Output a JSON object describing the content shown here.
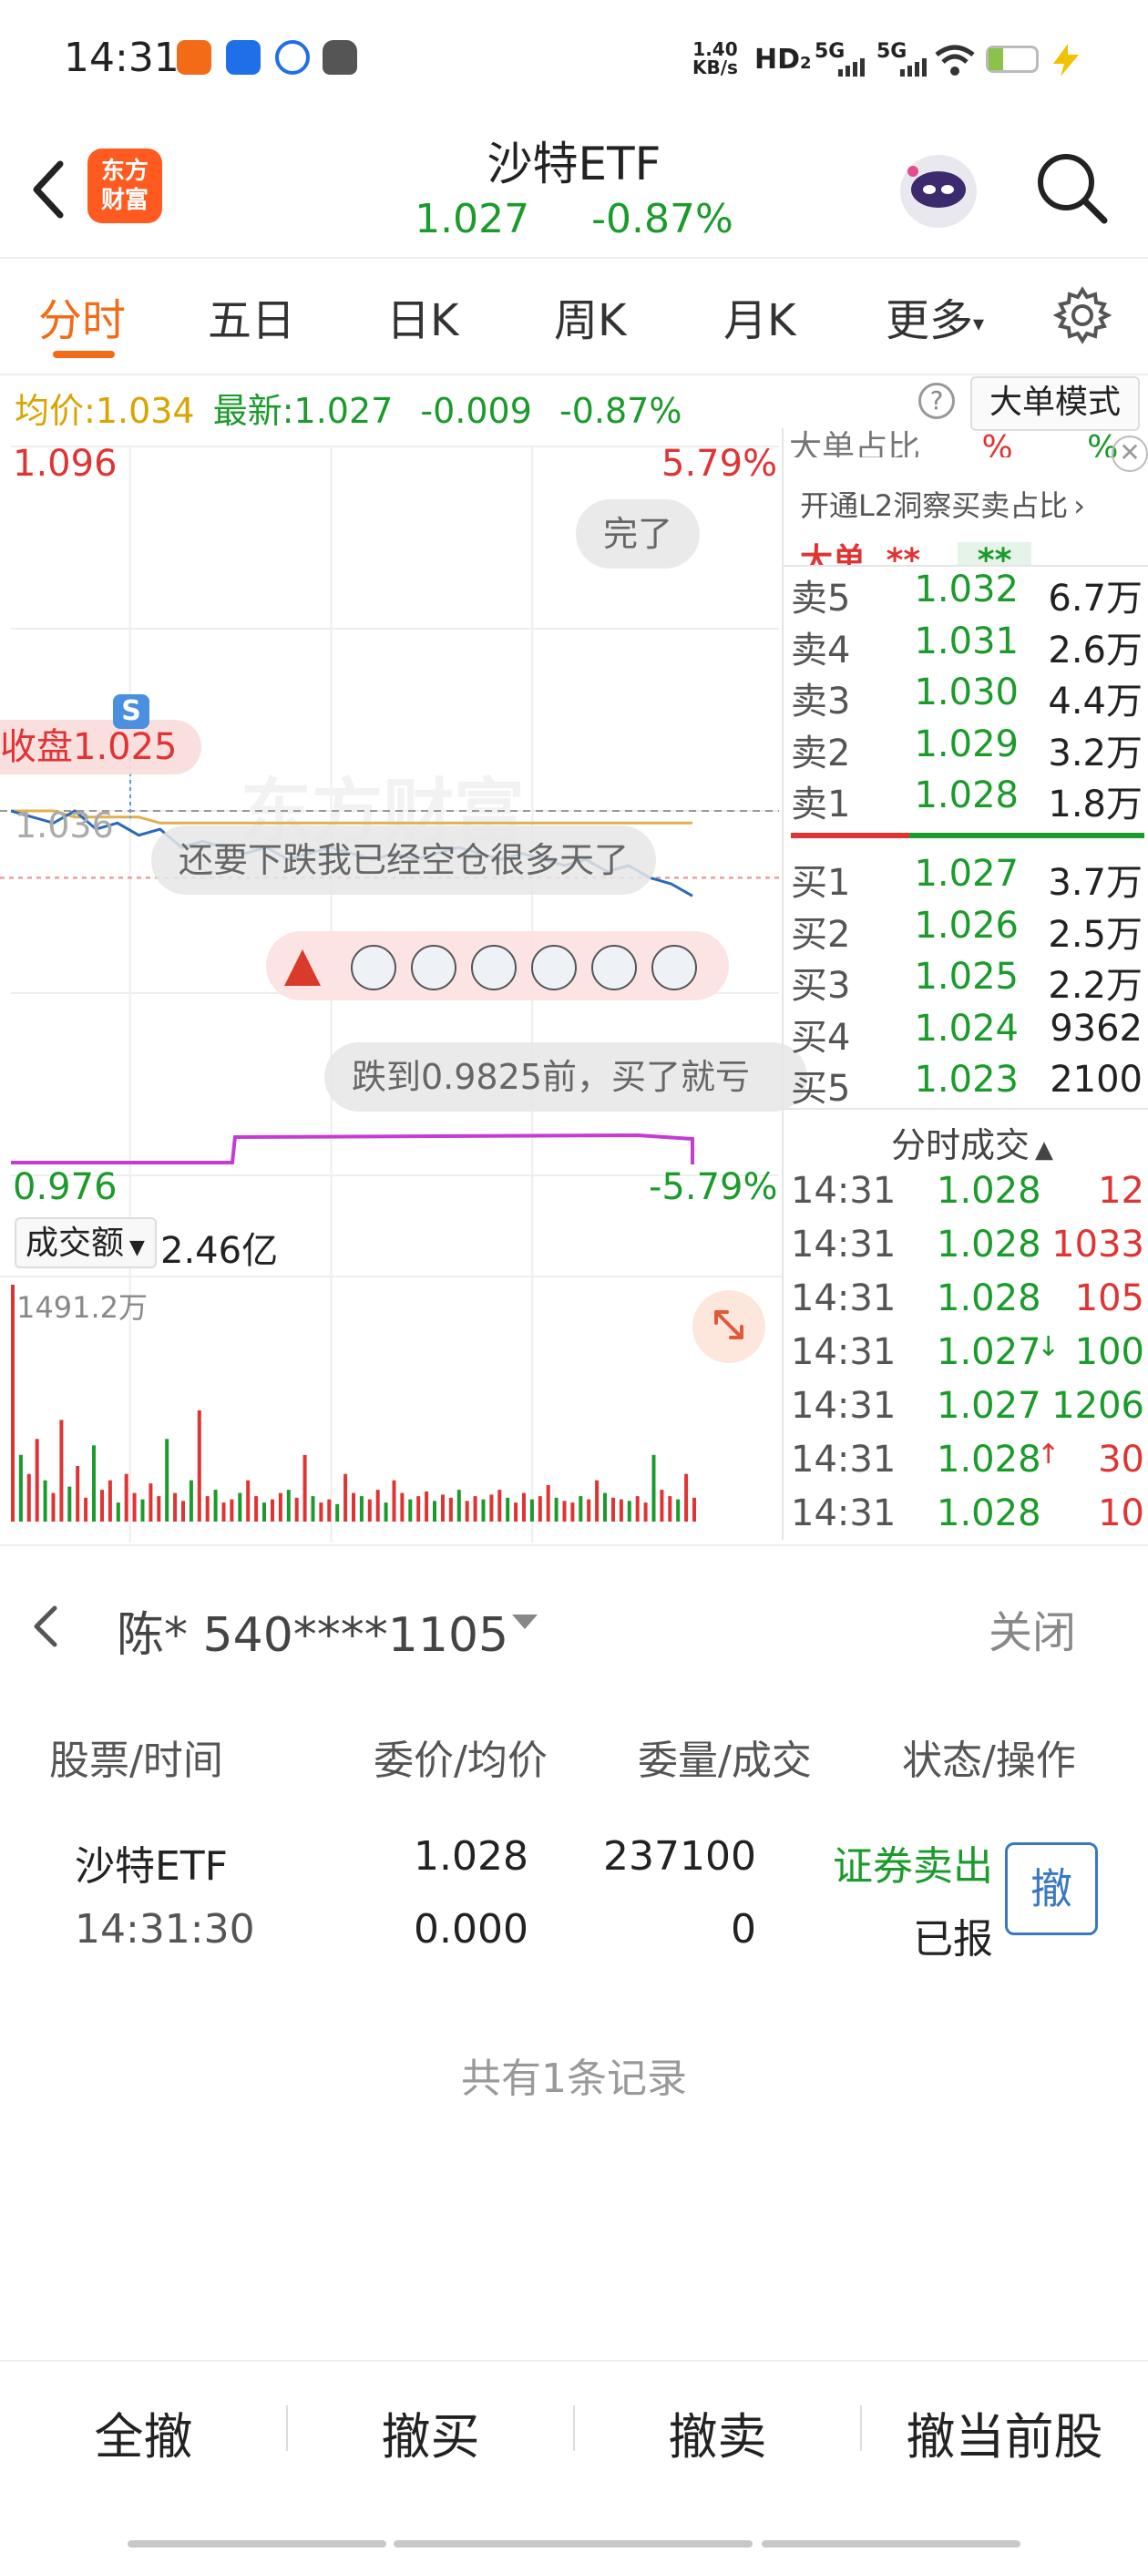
{
  "status_bar": {
    "time": "14:31",
    "net_speed": "1.40",
    "net_speed_unit": "KB/s",
    "hd": "HD",
    "hd_index": "1",
    "hd_sub": "2",
    "sig1": "5G",
    "sig2": "5G"
  },
  "header": {
    "logo_line1": "东方",
    "logo_line2": "财富",
    "title": "沙特ETF",
    "price": "1.027",
    "change_pct": "-0.87%"
  },
  "tabs": [
    {
      "label": "分时",
      "active": true
    },
    {
      "label": "五日"
    },
    {
      "label": "日K"
    },
    {
      "label": "周K"
    },
    {
      "label": "月K"
    },
    {
      "label": "更多"
    }
  ],
  "price_strip": {
    "avg_label": "均价:",
    "avg_value": "1.034",
    "latest_label": "最新:",
    "latest_value": "1.027",
    "change": "-0.009",
    "change_pct": "-0.87%",
    "help": "?",
    "bigorder_mode": "大单模式"
  },
  "chart": {
    "high": "1.096",
    "high_pct": "5.79%",
    "low": "0.976",
    "low_pct": "-5.79%",
    "prev_close_label": "收盘1.025",
    "mid_label": "1.036",
    "marker": "S",
    "watermark": "东方财富"
  },
  "danmaku": [
    "完了",
    "还要下跌我已经空仓很多天了",
    "跌到0.9825前，买了就亏"
  ],
  "orderbook": {
    "top_partial": "大单占比",
    "top_partial_pct1": "%",
    "top_partial_pct2": "%",
    "l2_promo": "开通L2洞察买卖占比",
    "bigorder_row": "大单",
    "bigorder_v1": "**",
    "bigorder_v2": "**",
    "asks": [
      {
        "label": "卖5",
        "price": "1.032",
        "vol": "6.7万"
      },
      {
        "label": "卖4",
        "price": "1.031",
        "vol": "2.6万"
      },
      {
        "label": "卖3",
        "price": "1.030",
        "vol": "4.4万"
      },
      {
        "label": "卖2",
        "price": "1.029",
        "vol": "3.2万"
      },
      {
        "label": "卖1",
        "price": "1.028",
        "vol": "1.8万"
      }
    ],
    "bids": [
      {
        "label": "买1",
        "price": "1.027",
        "vol": "3.7万"
      },
      {
        "label": "买2",
        "price": "1.026",
        "vol": "2.5万"
      },
      {
        "label": "买3",
        "price": "1.025",
        "vol": "2.2万"
      },
      {
        "label": "买4",
        "price": "1.024",
        "vol": "9362"
      },
      {
        "label": "买5",
        "price": "1.023",
        "vol": "2100"
      }
    ],
    "ticks_title": "分时成交",
    "ticks": [
      {
        "time": "14:31",
        "price": "1.028",
        "vol": "12"
      },
      {
        "time": "14:31",
        "price": "1.028",
        "vol": "1033"
      },
      {
        "time": "14:31",
        "price": "1.028",
        "vol": "105"
      },
      {
        "time": "14:31",
        "price": "1.027",
        "vol": "100",
        "arrow": "↓"
      },
      {
        "time": "14:31",
        "price": "1.027",
        "vol": "1206"
      },
      {
        "time": "14:31",
        "price": "1.028",
        "vol": "30",
        "arrow": "↑"
      },
      {
        "time": "14:31",
        "price": "1.028",
        "vol": "10"
      }
    ]
  },
  "volume": {
    "selector": "成交额",
    "total": "2.46亿",
    "max": "1491.2万"
  },
  "orders_sheet": {
    "account": "陈* 540****1105",
    "close": "关闭",
    "headers": [
      "股票/时间",
      "委价/均价",
      "委量/成交",
      "状态/操作"
    ],
    "row": {
      "name": "沙特ETF",
      "time": "14:31:30",
      "order_price": "1.028",
      "avg_price": "0.000",
      "order_qty": "237100",
      "filled_qty": "0",
      "direction": "证券卖出",
      "status": "已报",
      "cancel": "撤"
    },
    "records": "共有1条记录",
    "bottom_buttons": [
      "全撤",
      "撤买",
      "撤卖",
      "撤当前股"
    ]
  },
  "chart_data": {
    "type": "line",
    "series": [
      {
        "values": [
          1.036,
          1.035,
          1.034,
          1.036,
          1.033,
          1.034,
          1.032,
          1.033,
          1.03,
          1.031,
          1.03,
          1.029,
          1.03,
          1.028,
          1.029,
          1.03,
          1.029,
          1.028,
          1.029,
          1.028,
          1.029,
          1.03,
          1.029,
          1.028,
          1.029,
          1.028,
          1.027,
          1.028,
          1.026,
          1.027,
          1.025,
          1.024,
          1.022
        ]
      },
      {
        "values": [
          1.036,
          1.036,
          1.036,
          1.035,
          1.035,
          1.035,
          1.035,
          1.034,
          1.034,
          1.034,
          1.034,
          1.034,
          1.034,
          1.034,
          1.034,
          1.034,
          1.034,
          1.034,
          1.034,
          1.034,
          1.034,
          1.034,
          1.034,
          1.034,
          1.034,
          1.034,
          1.034,
          1.034,
          1.034,
          1.034,
          1.034,
          1.034,
          1.034
        ]
      }
    ],
    "ylim": [
      0.976,
      1.096
    ],
    "prev_close": 1.025,
    "volume_values": [
      1491,
      420,
      300,
      520,
      260,
      180,
      640,
      220,
      350,
      150,
      480,
      200,
      260,
      120,
      300,
      180,
      140,
      240,
      160,
      520,
      180,
      130,
      260,
      700,
      160,
      200,
      120,
      140,
      180,
      260,
      160,
      120,
      140,
      180,
      200,
      150,
      420,
      160,
      120,
      140,
      110,
      300,
      180,
      160,
      140,
      200,
      120,
      260,
      180,
      140,
      160,
      190,
      130,
      170,
      150,
      200,
      130,
      160,
      140,
      170,
      200,
      150,
      120,
      180,
      140,
      160,
      230,
      150,
      130,
      120,
      160,
      140,
      260,
      180,
      150,
      140,
      130,
      160,
      120,
      420,
      200,
      160,
      140,
      300,
      150
    ]
  }
}
